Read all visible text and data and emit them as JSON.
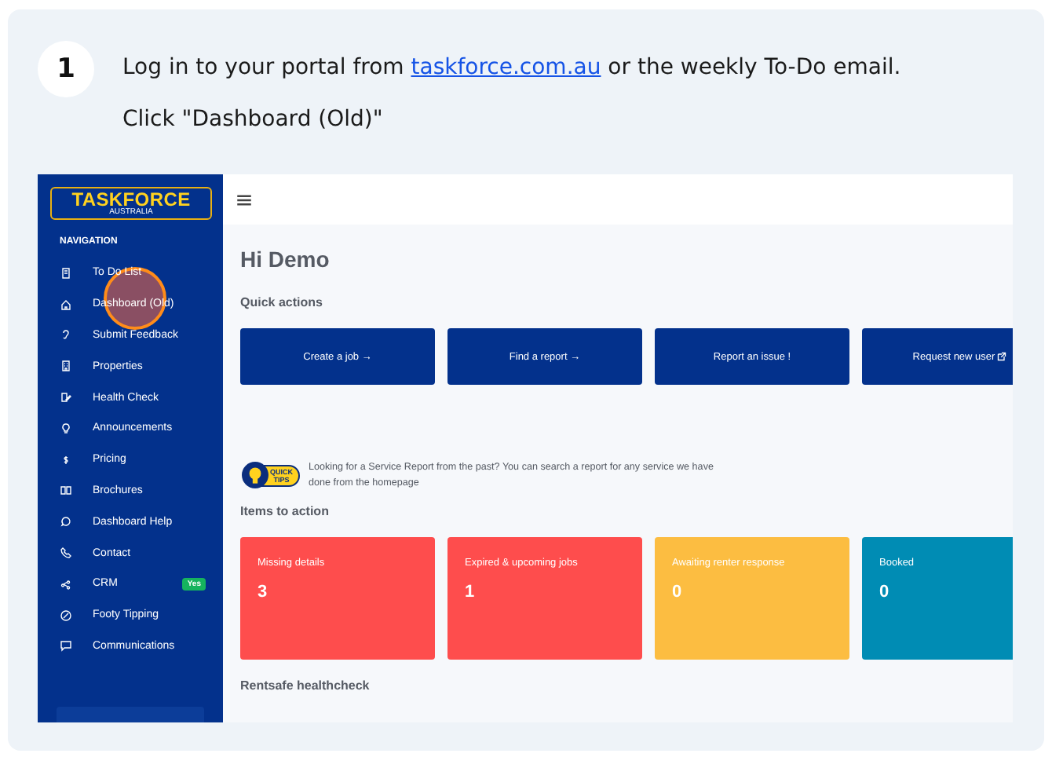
{
  "step": {
    "number": "1",
    "before": "Log in to your portal from ",
    "link": "taskforce.com.au",
    "after": " or the weekly To-Do email.",
    "action": "Click \"Dashboard (Old)\""
  },
  "app": {
    "logo": {
      "main": "TASKFORCE",
      "sub": "AUSTRALIA"
    },
    "sidebar": {
      "heading": "NAVIGATION",
      "items": [
        {
          "label": "To Do List",
          "highlighted": false
        },
        {
          "label": "Dashboard (Old)",
          "highlighted": true
        },
        {
          "label": "Submit Feedback",
          "highlighted": false
        },
        {
          "label": "Properties",
          "highlighted": false
        },
        {
          "label": "Health Check",
          "highlighted": false
        },
        {
          "label": "Announcements",
          "highlighted": false
        },
        {
          "label": "Pricing",
          "highlighted": false
        },
        {
          "label": "Brochures",
          "highlighted": false
        },
        {
          "label": "Dashboard Help",
          "highlighted": false
        },
        {
          "label": "Contact",
          "highlighted": false
        },
        {
          "label": "CRM",
          "highlighted": false,
          "badge": "Yes"
        },
        {
          "label": "Footy Tipping",
          "highlighted": false
        },
        {
          "label": "Communications",
          "highlighted": false
        }
      ]
    },
    "greeting": "Hi Demo",
    "quick_actions": {
      "heading": "Quick actions",
      "buttons": [
        "Create a job →",
        "Find a report →",
        "Report an issue !",
        "Request new user"
      ]
    },
    "tip": {
      "badge_top": "QUICK",
      "badge_bottom": "TIPS",
      "text": "Looking for a Service Report from the past? You can search a report for any service we have done from the homepage"
    },
    "items_to_action": {
      "heading": "Items to action",
      "cards": [
        {
          "label": "Missing details",
          "count": "3",
          "color": "#fe4d4d"
        },
        {
          "label": "Expired & upcoming jobs",
          "count": "1",
          "color": "#fe4d4d"
        },
        {
          "label": "Awaiting renter response",
          "count": "0",
          "color": "#fcbd41"
        },
        {
          "label": "Booked",
          "count": "0",
          "color": "#008cb4"
        }
      ]
    },
    "section": "Rentsafe healthcheck"
  }
}
